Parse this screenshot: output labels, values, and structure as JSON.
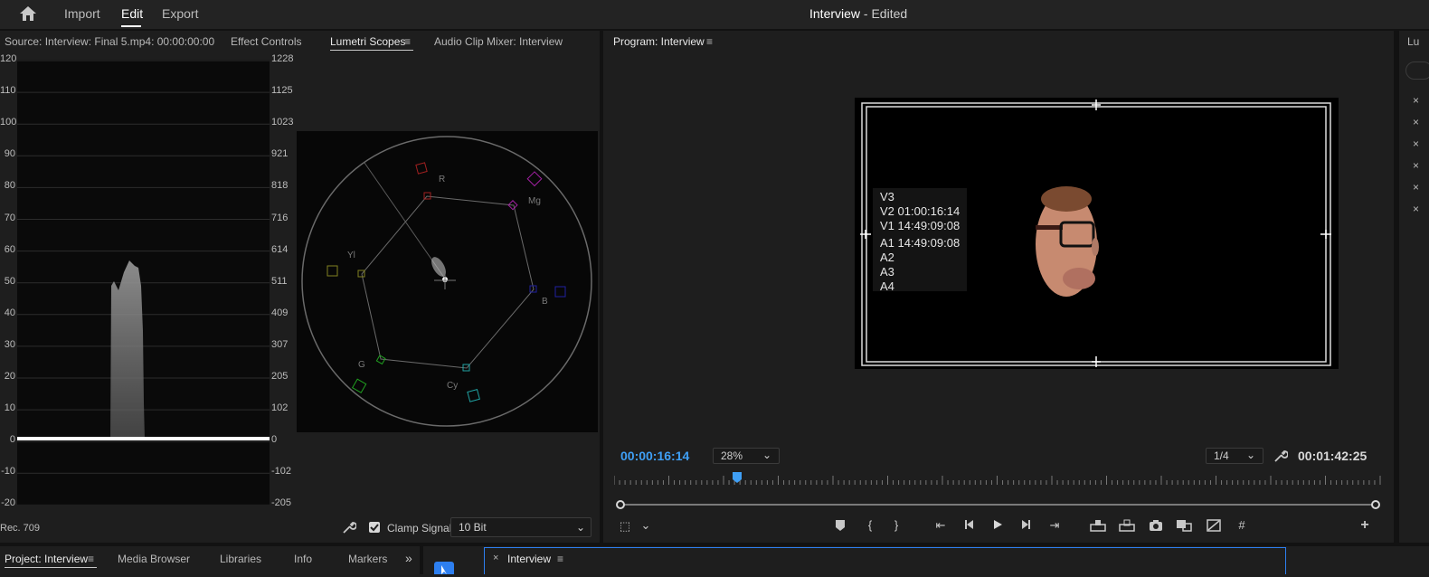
{
  "topbar": {
    "nav": [
      "Import",
      "Edit",
      "Export"
    ],
    "active_nav": "Edit",
    "doc_title": "Interview",
    "doc_status": " - Edited"
  },
  "source_panel": {
    "tabs": [
      "Source: Interview: Final 5.mp4: 00:00:00:00",
      "Effect Controls",
      "Lumetri Scopes",
      "Audio Clip Mixer: Interview"
    ],
    "active_tab": "Lumetri Scopes",
    "waveform_left_ticks": [
      "120",
      "110",
      "100",
      "90",
      "80",
      "70",
      "60",
      "50",
      "40",
      "30",
      "20",
      "10",
      "0",
      "-10",
      "-20"
    ],
    "waveform_right_ticks": [
      "1228",
      "1125",
      "1023",
      "921",
      "818",
      "716",
      "614",
      "511",
      "409",
      "307",
      "205",
      "102",
      "0",
      "-102",
      "-205"
    ],
    "color_space": "Rec. 709",
    "clamp_signal_label": "Clamp Signal",
    "clamp_signal_checked": true,
    "bit_depth": "10 Bit",
    "vectorscope_labels": [
      "R",
      "Mg",
      "Yl",
      "B",
      "G",
      "Cy"
    ]
  },
  "program_panel": {
    "tab": "Program: Interview",
    "overlay_lines": [
      "V3",
      "V2 01:00:16:14",
      "V1 14:49:09:08",
      "A1 14:49:09:08",
      "A2",
      "A3",
      "A4"
    ],
    "current_timecode": "00:00:16:14",
    "zoom": "28%",
    "resolution": "1/4",
    "duration_timecode": "00:01:42:25",
    "playhead_fraction": 0.16
  },
  "right_panel": {
    "tab_stub": "Lu"
  },
  "bottom_panel": {
    "tabs": [
      "Project: Interview",
      "Media Browser",
      "Libraries",
      "Info",
      "Markers"
    ],
    "active_tab": "Project: Interview",
    "timeline_tab": "Interview"
  },
  "colors": {
    "accent_blue": "#3f9ff5",
    "panel_bg": "#1e1e1e",
    "scope_bg": "#0a0a0a"
  }
}
